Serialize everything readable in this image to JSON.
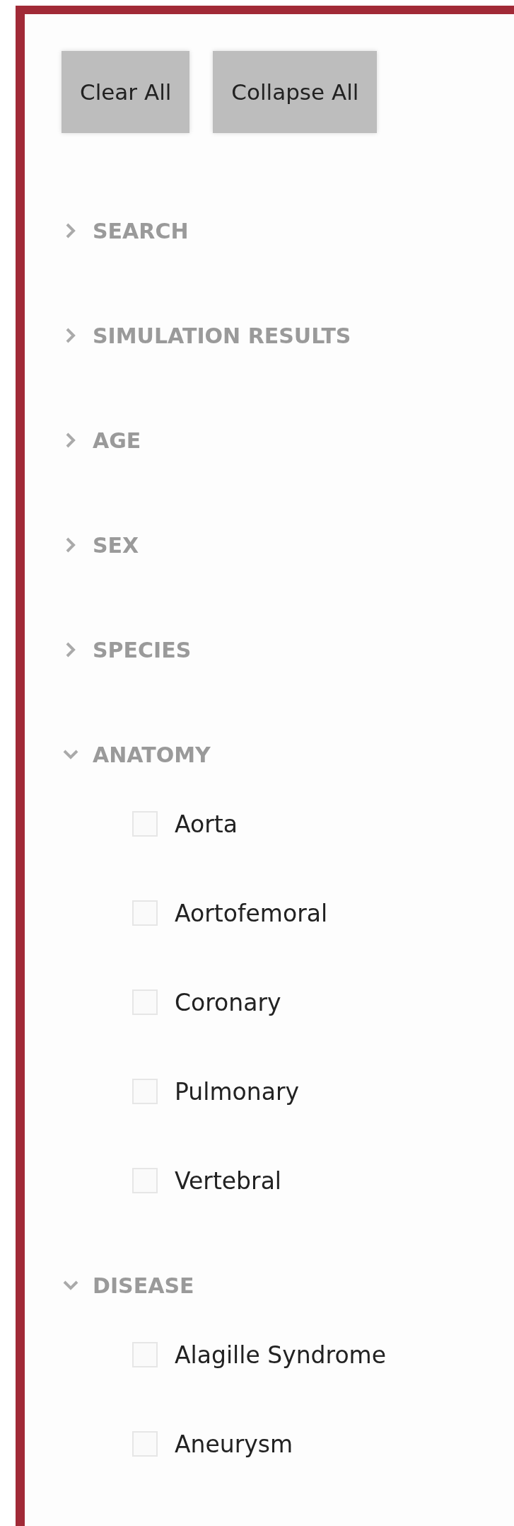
{
  "buttons": [
    "Clear All",
    "Collapse All"
  ],
  "sections": [
    {
      "title": "SEARCH",
      "expanded": false
    },
    {
      "title": "SIMULATION RESULTS",
      "expanded": false
    },
    {
      "title": "AGE",
      "expanded": false
    },
    {
      "title": "SEX",
      "expanded": false
    },
    {
      "title": "SPECIES",
      "expanded": false
    },
    {
      "title": "ANATOMY",
      "expanded": true,
      "items": [
        {
          "label": "Aorta",
          "checked": false
        },
        {
          "label": "Aortofemoral",
          "checked": false
        },
        {
          "label": "Coronary",
          "checked": false
        },
        {
          "label": "Pulmonary",
          "checked": false
        },
        {
          "label": "Vertebral",
          "checked": false
        }
      ]
    },
    {
      "title": "DISEASE",
      "expanded": true,
      "items": [
        {
          "label": "Alagille Syndrome",
          "checked": false
        },
        {
          "label": "Aneurysm",
          "checked": false
        }
      ]
    }
  ]
}
